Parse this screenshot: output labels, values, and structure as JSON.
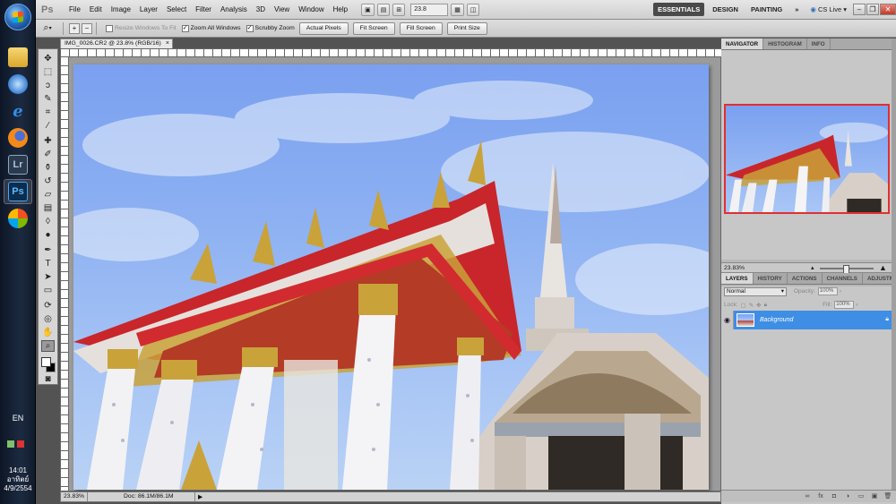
{
  "taskbar": {
    "language": "EN",
    "clock_time": "14:01",
    "clock_day": "อาทิตย์",
    "clock_date": "4/9/2554",
    "apps": [
      {
        "name": "explorer",
        "label": ""
      },
      {
        "name": "ie",
        "label": ""
      },
      {
        "name": "ie-browser",
        "label": "e"
      },
      {
        "name": "firefox",
        "label": ""
      },
      {
        "name": "lightroom",
        "label": "Lr"
      },
      {
        "name": "photoshop",
        "label": "Ps"
      },
      {
        "name": "media",
        "label": ""
      }
    ]
  },
  "menubar": {
    "logo": "Ps",
    "items": [
      "File",
      "Edit",
      "Image",
      "Layer",
      "Select",
      "Filter",
      "Analysis",
      "3D",
      "View",
      "Window",
      "Help"
    ],
    "zoom_value": "23.8",
    "workspaces": [
      "ESSENTIALS",
      "DESIGN",
      "PAINTING"
    ],
    "more": "»",
    "cs_live": "CS Live"
  },
  "options": {
    "resize_windows": "Resize Windows To Fit",
    "zoom_all_windows": "Zoom All Windows",
    "scrubby_zoom": "Scrubby Zoom",
    "buttons": [
      "Actual Pixels",
      "Fit Screen",
      "Fill Screen",
      "Print Size"
    ]
  },
  "document": {
    "tab_title": "IMG_0026.CR2 @ 23.8% (RGB/16)",
    "tab_close": "×",
    "status_zoom": "23.83%",
    "status_doc": "Doc: 86.1M/86.1M",
    "status_arrow": "▶"
  },
  "navigator": {
    "tabs": [
      "NAVIGATOR",
      "HISTOGRAM",
      "INFO"
    ],
    "zoom": "23.83%"
  },
  "layers": {
    "tabs": [
      "LAYERS",
      "HISTORY",
      "ACTIONS",
      "CHANNELS",
      "ADJUSTME"
    ],
    "blend_mode": "Normal",
    "opacity_label": "Opacity:",
    "opacity_value": "100%",
    "lock_label": "Lock:",
    "fill_label": "Fill:",
    "fill_value": "100%",
    "layer_name": "Background"
  },
  "colors": {
    "selected_layer": "#3e8ee6",
    "nav_frame": "#e03030",
    "roof_red": "#c8262b",
    "gold": "#c9a23a"
  }
}
